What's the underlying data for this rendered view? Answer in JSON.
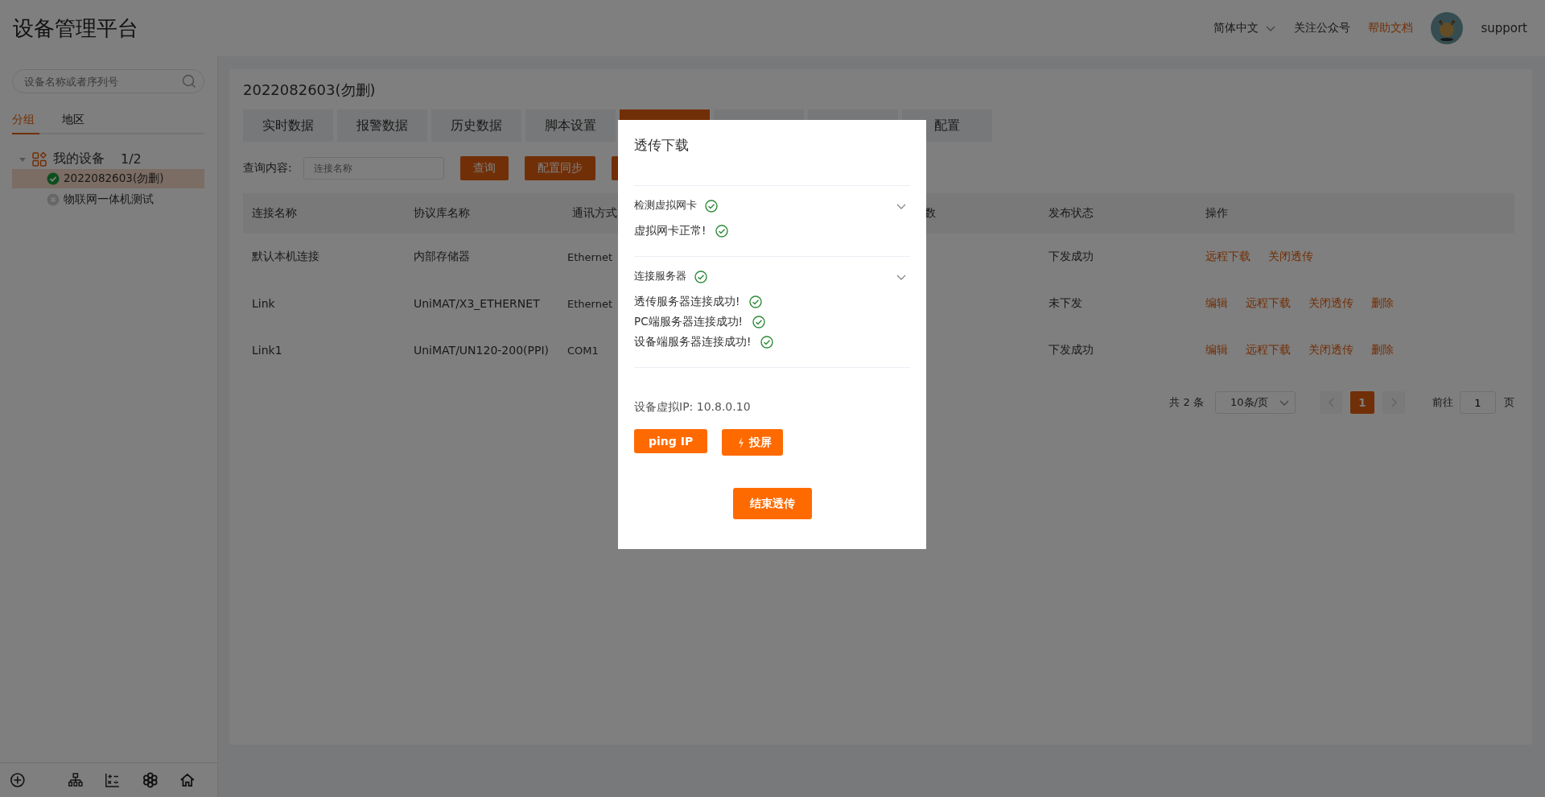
{
  "header": {
    "title": "设备管理平台",
    "language": "简体中文",
    "links": [
      {
        "label": "关注公众号",
        "kind": "plain"
      },
      {
        "label": "帮助文档",
        "kind": "accent"
      }
    ],
    "user": "support"
  },
  "sidebar": {
    "search": {
      "placeholder": "设备名称或者序列号"
    },
    "tabs": [
      {
        "label": "分组",
        "selected": true
      },
      {
        "label": "地区",
        "selected": false
      }
    ],
    "tree": [
      {
        "label": "我的设备",
        "count": "1/2",
        "expanded": true,
        "children": [
          {
            "label": "2022082603(勿删)",
            "online": true,
            "selected": true
          },
          {
            "label": "物联网一体机测试",
            "online": false,
            "selected": false
          }
        ]
      }
    ]
  },
  "device_title": "2022082603(勿删)",
  "tabs": [
    {
      "label": "实时数据",
      "selected": false
    },
    {
      "label": "报警数据",
      "selected": false
    },
    {
      "label": "历史数据",
      "selected": false
    },
    {
      "label": "脚本设置",
      "selected": false
    },
    {
      "selected": true
    },
    {
      "selected": false
    },
    {
      "selected": false
    },
    {
      "label": "配置",
      "selected": false
    }
  ],
  "toolbar": {
    "label": "查询内容:",
    "search": {
      "placeholder": "连接名称"
    },
    "buttons": [
      {
        "label": "查询"
      },
      {
        "label": "配置同步"
      }
    ],
    "covered_button": true
  },
  "table": {
    "columns": [
      "连接名称",
      "协议库名称",
      "通讯方式",
      "",
      "数",
      "发布状态",
      "操作"
    ],
    "rows": [
      {
        "cells": [
          "默认本机连接",
          "内部存储器",
          "Ethernet",
          "",
          "",
          "下发成功"
        ],
        "actions": [
          "远程下载",
          "关闭透传"
        ]
      },
      {
        "cells": [
          "Link",
          "UniMAT/X3_ETHERNET",
          "Ethernet",
          "",
          "",
          "未下发"
        ],
        "actions": [
          "编辑",
          "远程下载",
          "关闭透传",
          "删除"
        ]
      },
      {
        "cells": [
          "Link1",
          "UniMAT/UN120-200(PPI)",
          "COM1",
          "",
          "",
          "下发成功"
        ],
        "actions": [
          "编辑",
          "远程下载",
          "关闭透传",
          "删除"
        ]
      }
    ]
  },
  "pagination": {
    "total": "共 2 条",
    "page_size": "10条/页",
    "pages": [
      {
        "label": "1",
        "selected": true
      }
    ],
    "goto_label": "前往",
    "goto_value": "1",
    "goto_suffix": "页"
  },
  "dialog": {
    "title": "透传下载",
    "sections": [
      {
        "title": "检测虚拟网卡",
        "ok": true,
        "expanded": true,
        "items": [
          {
            "text": "虚拟网卡正常!",
            "ok": true
          }
        ]
      },
      {
        "title": "连接服务器",
        "ok": true,
        "expanded": true,
        "items": [
          {
            "text": "透传服务器连接成功!",
            "ok": true
          },
          {
            "text": "PC端服务器连接成功!",
            "ok": true
          },
          {
            "text": "设备端服务器连接成功!",
            "ok": true
          }
        ]
      }
    ],
    "ip": "设备虚拟IP: 10.8.0.10",
    "buttons": [
      {
        "label": "ping IP",
        "kind": "plain"
      },
      {
        "label": "投屏",
        "kind": "flash"
      }
    ],
    "footer_button": "结束透传"
  }
}
